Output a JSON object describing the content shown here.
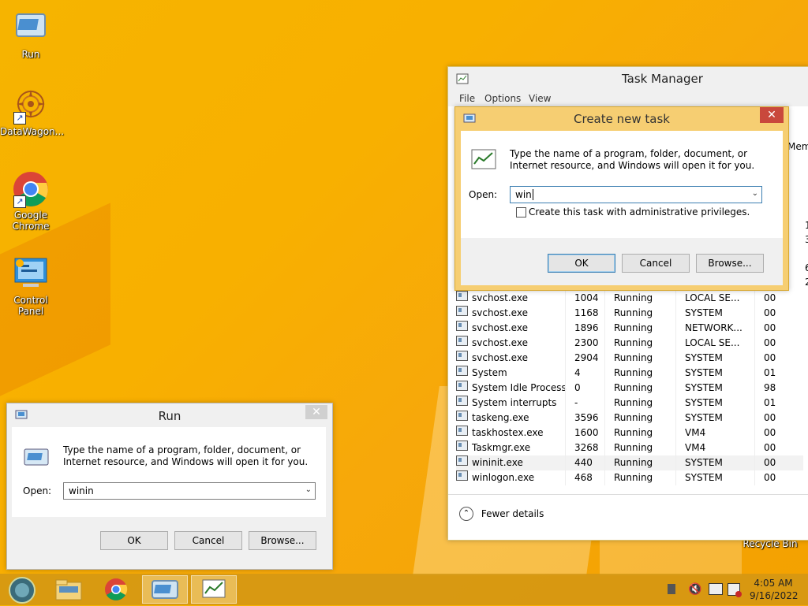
{
  "desktop": {
    "icons": [
      {
        "label": "Run",
        "icon": "run-icon"
      },
      {
        "label": "DataWagon...",
        "icon": "datawagon-icon"
      },
      {
        "label": "Google Chrome",
        "icon": "chrome-icon"
      },
      {
        "label": "Control Panel",
        "icon": "control-panel-icon"
      },
      {
        "label": "Recycle Bin",
        "icon": "recycle-bin-icon"
      }
    ]
  },
  "task_manager": {
    "title": "Task Manager",
    "menu": [
      "File",
      "Options",
      "View"
    ],
    "partial_header": "Mem",
    "rows": [
      {
        "name": "svchost.exe",
        "pid": "1004",
        "status": "Running",
        "user": "LOCAL SE...",
        "cpu": "00"
      },
      {
        "name": "svchost.exe",
        "pid": "1168",
        "status": "Running",
        "user": "SYSTEM",
        "cpu": "00"
      },
      {
        "name": "svchost.exe",
        "pid": "1896",
        "status": "Running",
        "user": "NETWORK...",
        "cpu": "00"
      },
      {
        "name": "svchost.exe",
        "pid": "2300",
        "status": "Running",
        "user": "LOCAL SE...",
        "cpu": "00"
      },
      {
        "name": "svchost.exe",
        "pid": "2904",
        "status": "Running",
        "user": "SYSTEM",
        "cpu": "00"
      },
      {
        "name": "System",
        "pid": "4",
        "status": "Running",
        "user": "SYSTEM",
        "cpu": "01"
      },
      {
        "name": "System Idle Process",
        "pid": "0",
        "status": "Running",
        "user": "SYSTEM",
        "cpu": "98"
      },
      {
        "name": "System interrupts",
        "pid": "-",
        "status": "Running",
        "user": "SYSTEM",
        "cpu": "01"
      },
      {
        "name": "taskeng.exe",
        "pid": "3596",
        "status": "Running",
        "user": "SYSTEM",
        "cpu": "00"
      },
      {
        "name": "taskhostex.exe",
        "pid": "1600",
        "status": "Running",
        "user": "VM4",
        "cpu": "00"
      },
      {
        "name": "Taskmgr.exe",
        "pid": "3268",
        "status": "Running",
        "user": "VM4",
        "cpu": "00"
      },
      {
        "name": "wininit.exe",
        "pid": "440",
        "status": "Running",
        "user": "SYSTEM",
        "cpu": "00"
      },
      {
        "name": "winlogon.exe",
        "pid": "468",
        "status": "Running",
        "user": "SYSTEM",
        "cpu": "00"
      }
    ],
    "fewer_details": "Fewer details"
  },
  "create_task": {
    "title": "Create new task",
    "description": "Type the name of a program, folder, document, or Internet resource, and Windows will open it for you.",
    "open_label": "Open:",
    "open_value": "win",
    "admin_checkbox_label": "Create this task with administrative privileges.",
    "ok": "OK",
    "cancel": "Cancel",
    "browse": "Browse..."
  },
  "run_dialog": {
    "title": "Run",
    "description": "Type the name of a program, folder, document, or Internet resource, and Windows will open it for you.",
    "open_label": "Open:",
    "open_value": "winin",
    "ok": "OK",
    "cancel": "Cancel",
    "browse": "Browse..."
  },
  "taskbar": {
    "time": "4:05 AM",
    "date": "9/16/2022"
  }
}
